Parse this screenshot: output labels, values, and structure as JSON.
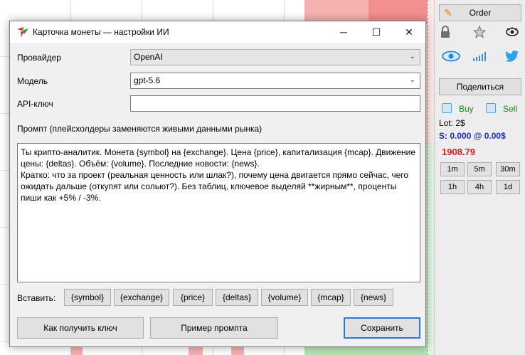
{
  "dialog": {
    "title": "Карточка монеты — настройки ИИ",
    "window_controls": {
      "minimize": "─",
      "maximize": "☐",
      "close": "✕"
    },
    "provider": {
      "label": "Провайдер",
      "value": "OpenAI"
    },
    "model": {
      "label": "Модель",
      "value": "gpt-5.6"
    },
    "api_key": {
      "label": "API-ключ",
      "value": ""
    },
    "prompt": {
      "label": "Промпт (плейсхолдеры заменяются живыми данными рынка)",
      "value": "Ты крипто-аналитик. Монета {symbol} на {exchange}. Цена {price}, капитализация {mcap}. Движение цены: {deltas}. Объём: {volume}. Последние новости: {news}.\nКратко: что за проект (реальная ценность или шлак?), почему цена двигается прямо сейчас, чего ожидать дальше (откупят или сольют?). Без таблиц, ключевое выделяй **жирным**, проценты пиши как +5% / -3%."
    },
    "insert_label": "Вставить:",
    "tokens": [
      "{symbol}",
      "{exchange}",
      "{price}",
      "{deltas}",
      "{volume}",
      "{mcap}",
      "{news}"
    ],
    "buttons": {
      "how_to_get_key": "Как получить ключ",
      "prompt_example": "Пример промпта",
      "save": "Сохранить"
    }
  },
  "sidebar": {
    "order_label": "Order",
    "share_label": "Поделиться",
    "buy_label": "Buy",
    "sell_label": "Sell",
    "lot": "Lot: 2$",
    "stat": "S: 0.000 @ 0.00$",
    "price": "1908.79",
    "timeframes": [
      "1m",
      "5m",
      "30m",
      "1h",
      "4h",
      "1d"
    ],
    "colors": {
      "price": "#d41f1f",
      "stat": "#1a2ad6",
      "buy_sell": "#1a7f1a",
      "accent": "#2a7bd3"
    }
  }
}
